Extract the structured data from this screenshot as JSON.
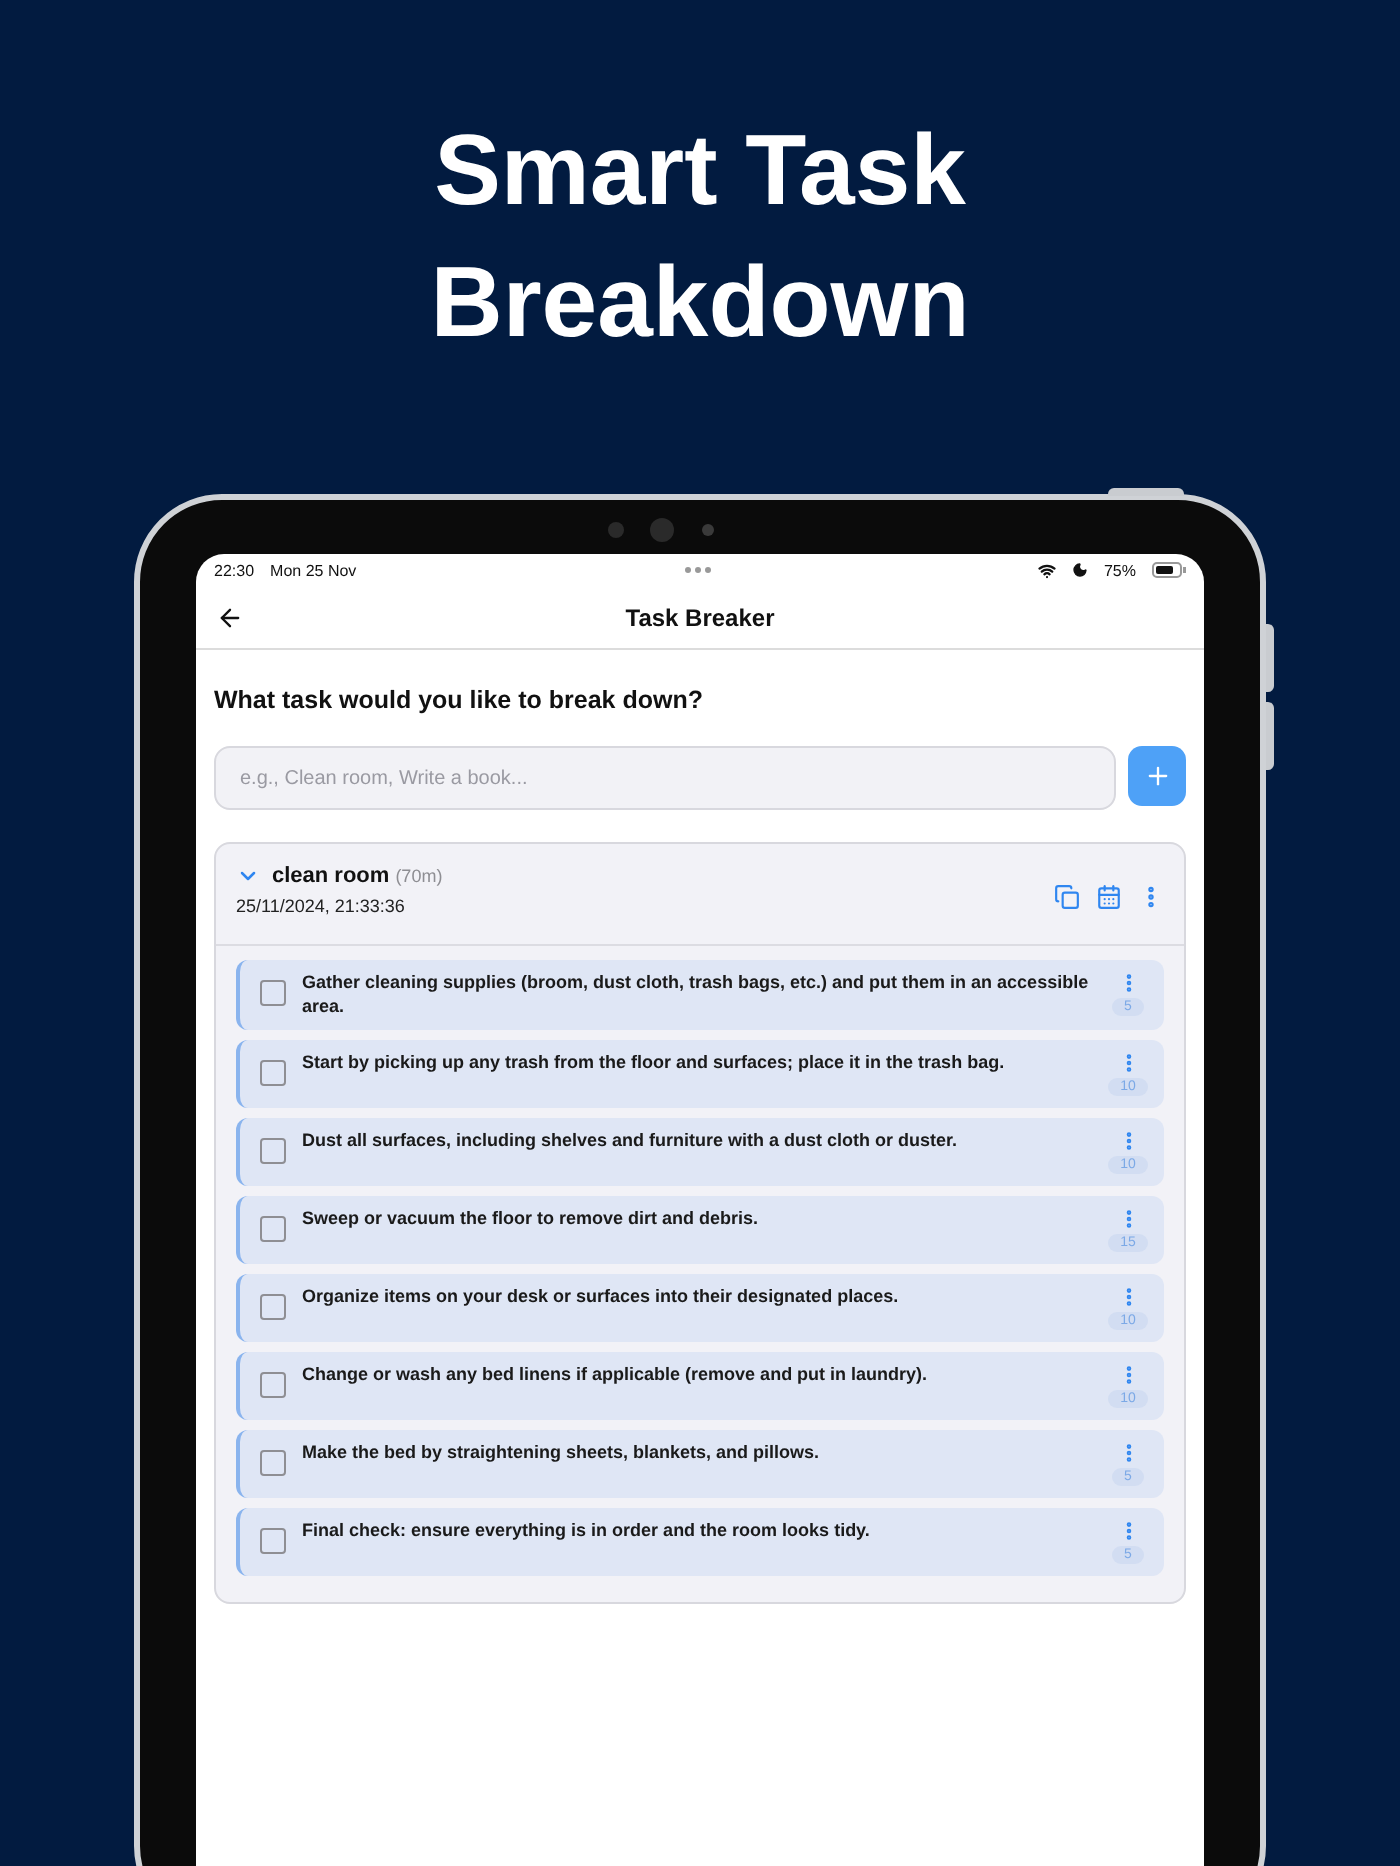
{
  "headline": "Smart Task Breakdown",
  "status_bar": {
    "time": "22:30",
    "date": "Mon 25 Nov",
    "battery": "75%"
  },
  "nav": {
    "title": "Task Breaker"
  },
  "prompt": "What task would you like to break down?",
  "task_input": {
    "placeholder": "e.g., Clean room, Write a book..."
  },
  "task": {
    "name": "clean room",
    "duration": "(70m)",
    "timestamp": "25/11/2024, 21:33:36",
    "expanded": true,
    "subtasks": [
      {
        "text": "Gather cleaning supplies (broom, dust cloth, trash bags, etc.) and put them in an accessible area.",
        "checked": false,
        "minutes": "5"
      },
      {
        "text": "Start by picking up any trash from the floor and surfaces; place it in the trash bag.",
        "checked": false,
        "minutes": "10"
      },
      {
        "text": "Dust all surfaces, including shelves and furniture with a dust cloth or duster.",
        "checked": false,
        "minutes": "10"
      },
      {
        "text": "Sweep or vacuum the floor to remove dirt and debris.",
        "checked": false,
        "minutes": "15"
      },
      {
        "text": "Organize items on your desk or surfaces into their designated places.",
        "checked": false,
        "minutes": "10"
      },
      {
        "text": "Change or wash any bed linens if applicable (remove and put in laundry).",
        "checked": false,
        "minutes": "10"
      },
      {
        "text": "Make the bed by straightening sheets, blankets, and pillows.",
        "checked": false,
        "minutes": "5"
      },
      {
        "text": "Final check: ensure everything is in order and the room looks tidy.",
        "checked": false,
        "minutes": "5"
      }
    ]
  }
}
